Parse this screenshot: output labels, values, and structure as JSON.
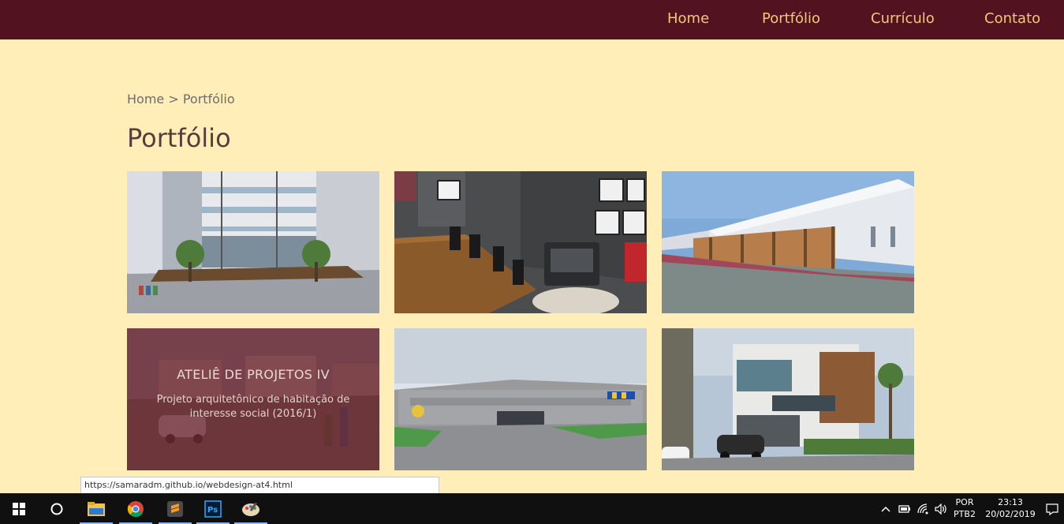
{
  "nav": {
    "items": [
      {
        "label": "Home"
      },
      {
        "label": "Portfólio"
      },
      {
        "label": "Currículo"
      },
      {
        "label": "Contato"
      }
    ]
  },
  "breadcrumb": {
    "home": "Home",
    "separator": " > ",
    "current": "Portfólio"
  },
  "page": {
    "title": "Portfólio"
  },
  "portfolio": {
    "featured": {
      "title": "ATELIÊ DE PROJETOS IV",
      "description": "Projeto arquitetônico de habitação de interesse social (2016/1)"
    }
  },
  "browser": {
    "status_url": "https://samaradm.github.io/webdesign-at4.html"
  },
  "taskbar": {
    "language": "POR",
    "layout": "PTB2",
    "time": "23:13",
    "date": "20/02/2019"
  },
  "colors": {
    "header_bg": "#52121F",
    "nav_text": "#F2C77A",
    "page_bg": "#FFEEB8",
    "overlay": "#6C2530"
  }
}
